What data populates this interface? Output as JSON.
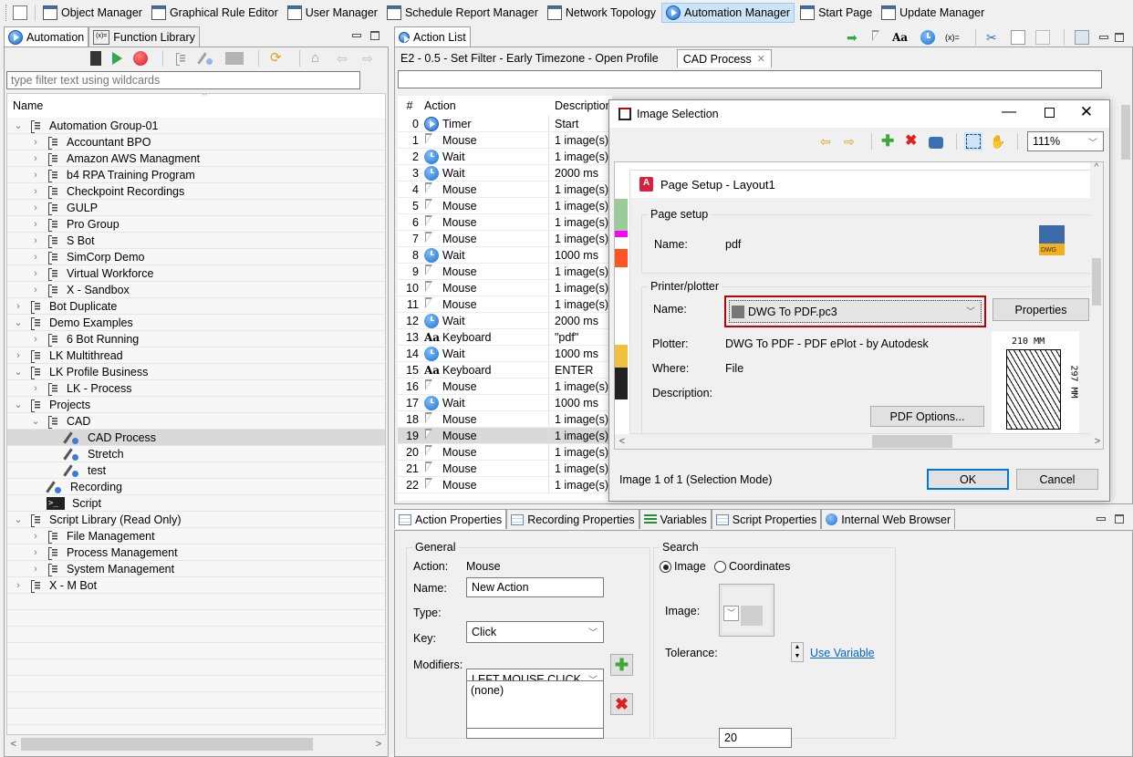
{
  "toolbar": {
    "items": [
      {
        "label": "Object Manager",
        "icon": "object-manager-icon"
      },
      {
        "label": "Graphical Rule Editor",
        "icon": "rule-editor-icon"
      },
      {
        "label": "User Manager",
        "icon": "users-icon"
      },
      {
        "label": "Schedule Report Manager",
        "icon": "schedule-icon"
      },
      {
        "label": "Network Topology",
        "icon": "network-icon"
      },
      {
        "label": "Automation Manager",
        "icon": "automation-icon",
        "active": true
      },
      {
        "label": "Start Page",
        "icon": "checkered-flag-icon"
      },
      {
        "label": "Update Manager",
        "icon": "update-icon"
      }
    ]
  },
  "left_panel": {
    "tabs": [
      {
        "label": "Automation",
        "active": true
      },
      {
        "label": "Function Library"
      }
    ],
    "filter_placeholder": "type filter text using wildcards",
    "column_header": "Name",
    "tree": [
      {
        "label": "Automation Group-01",
        "level": 0,
        "expander": "open",
        "icon": "group"
      },
      {
        "label": "Accountant BPO",
        "level": 1,
        "expander": "closed",
        "icon": "group"
      },
      {
        "label": "Amazon AWS Managment",
        "level": 1,
        "expander": "closed",
        "icon": "group"
      },
      {
        "label": "b4 RPA Training Program",
        "level": 1,
        "expander": "closed",
        "icon": "group"
      },
      {
        "label": "Checkpoint Recordings",
        "level": 1,
        "expander": "closed",
        "icon": "group"
      },
      {
        "label": "GULP",
        "level": 1,
        "expander": "closed",
        "icon": "group"
      },
      {
        "label": "Pro Group",
        "level": 1,
        "expander": "closed",
        "icon": "group"
      },
      {
        "label": "S Bot",
        "level": 1,
        "expander": "closed",
        "icon": "group"
      },
      {
        "label": "SimCorp Demo",
        "level": 1,
        "expander": "closed",
        "icon": "group"
      },
      {
        "label": "Virtual Workforce",
        "level": 1,
        "expander": "closed",
        "icon": "group"
      },
      {
        "label": "X - Sandbox",
        "level": 1,
        "expander": "closed",
        "icon": "group"
      },
      {
        "label": "Bot Duplicate",
        "level": 0,
        "expander": "closed",
        "icon": "group"
      },
      {
        "label": "Demo Examples",
        "level": 0,
        "expander": "open",
        "icon": "group"
      },
      {
        "label": "6 Bot Running",
        "level": 1,
        "expander": "closed",
        "icon": "group"
      },
      {
        "label": "LK Multithread",
        "level": 0,
        "expander": "closed",
        "icon": "group"
      },
      {
        "label": "LK Profile Business",
        "level": 0,
        "expander": "open",
        "icon": "group"
      },
      {
        "label": "LK - Process",
        "level": 1,
        "expander": "closed",
        "icon": "group"
      },
      {
        "label": "Projects",
        "level": 0,
        "expander": "open",
        "icon": "group"
      },
      {
        "label": "CAD",
        "level": 1,
        "expander": "open",
        "icon": "group"
      },
      {
        "label": "CAD Process",
        "level": 2,
        "expander": "none",
        "icon": "recording",
        "selected": true
      },
      {
        "label": "Stretch",
        "level": 2,
        "expander": "none",
        "icon": "recording"
      },
      {
        "label": "test",
        "level": 2,
        "expander": "none",
        "icon": "recording"
      },
      {
        "label": "Recording",
        "level": 1,
        "expander": "none",
        "icon": "recording"
      },
      {
        "label": "Script",
        "level": 1,
        "expander": "none",
        "icon": "script"
      },
      {
        "label": "Script Library (Read Only)",
        "level": 0,
        "expander": "open",
        "icon": "group"
      },
      {
        "label": "File Management",
        "level": 1,
        "expander": "closed",
        "icon": "group"
      },
      {
        "label": "Process Management",
        "level": 1,
        "expander": "closed",
        "icon": "group"
      },
      {
        "label": "System Management",
        "level": 1,
        "expander": "closed",
        "icon": "group"
      },
      {
        "label": "X - M Bot",
        "level": 0,
        "expander": "closed",
        "icon": "group"
      }
    ]
  },
  "action_list": {
    "view_title": "Action List",
    "editor_tabs": [
      {
        "label": "E2 - 0.5 - Set Filter - Early Timezone - Open Profile"
      },
      {
        "label": "CAD Process",
        "active": true,
        "closable": true
      }
    ],
    "columns": [
      "#",
      "Action",
      "Description"
    ],
    "rows": [
      {
        "n": "0",
        "action": "Timer",
        "icon": "timer",
        "desc": "Start"
      },
      {
        "n": "1",
        "action": "Mouse",
        "icon": "mouse",
        "desc": "1 image(s)"
      },
      {
        "n": "2",
        "action": "Wait",
        "icon": "wait",
        "desc": "1 image(s)"
      },
      {
        "n": "3",
        "action": "Wait",
        "icon": "wait",
        "desc": "2000 ms"
      },
      {
        "n": "4",
        "action": "Mouse",
        "icon": "mouse",
        "desc": "1 image(s)"
      },
      {
        "n": "5",
        "action": "Mouse",
        "icon": "mouse",
        "desc": "1 image(s)"
      },
      {
        "n": "6",
        "action": "Mouse",
        "icon": "mouse",
        "desc": "1 image(s)"
      },
      {
        "n": "7",
        "action": "Mouse",
        "icon": "mouse",
        "desc": "1 image(s)"
      },
      {
        "n": "8",
        "action": "Wait",
        "icon": "wait",
        "desc": "1000 ms"
      },
      {
        "n": "9",
        "action": "Mouse",
        "icon": "mouse",
        "desc": "1 image(s)"
      },
      {
        "n": "10",
        "action": "Mouse",
        "icon": "mouse",
        "desc": "1 image(s)"
      },
      {
        "n": "11",
        "action": "Mouse",
        "icon": "mouse",
        "desc": "1 image(s)"
      },
      {
        "n": "12",
        "action": "Wait",
        "icon": "wait",
        "desc": "2000 ms"
      },
      {
        "n": "13",
        "action": "Keyboard",
        "icon": "keyboard",
        "desc": "\"pdf\""
      },
      {
        "n": "14",
        "action": "Wait",
        "icon": "wait",
        "desc": "1000 ms"
      },
      {
        "n": "15",
        "action": "Keyboard",
        "icon": "keyboard",
        "desc": "ENTER"
      },
      {
        "n": "16",
        "action": "Mouse",
        "icon": "mouse",
        "desc": "1 image(s)"
      },
      {
        "n": "17",
        "action": "Wait",
        "icon": "wait",
        "desc": "1000 ms"
      },
      {
        "n": "18",
        "action": "Mouse",
        "icon": "mouse",
        "desc": "1 image(s)"
      },
      {
        "n": "19",
        "action": "Mouse",
        "icon": "mouse",
        "desc": "1 image(s)",
        "selected": true
      },
      {
        "n": "20",
        "action": "Mouse",
        "icon": "mouse",
        "desc": "1 image(s)"
      },
      {
        "n": "21",
        "action": "Mouse",
        "icon": "mouse",
        "desc": "1 image(s)"
      },
      {
        "n": "22",
        "action": "Mouse",
        "icon": "mouse",
        "desc": "1 image(s)"
      }
    ],
    "keyboard_glyph": "Aa"
  },
  "image_dialog": {
    "title": "Image Selection",
    "zoom": "111%",
    "status": "Image 1 of 1 (Selection Mode)",
    "ok_label": "OK",
    "cancel_label": "Cancel",
    "captured": {
      "title": "Page Setup - Layout1",
      "page_setup_group": "Page setup",
      "name_label": "Name:",
      "name_value": "pdf",
      "dwg_badge": "DWG",
      "printer_group": "Printer/plotter",
      "printer_name_label": "Name:",
      "printer_value": "DWG To PDF.pc3",
      "properties_label": "Properties",
      "plotter_label": "Plotter:",
      "plotter_value": "DWG To PDF - PDF ePlot - by Autodesk",
      "where_label": "Where:",
      "where_value": "File",
      "description_label": "Description:",
      "pdf_options_label": "PDF Options...",
      "paper_width": "210 MM",
      "paper_height": "297 MM"
    }
  },
  "bottom_tabs": [
    {
      "label": "Action Properties",
      "active": true
    },
    {
      "label": "Recording Properties"
    },
    {
      "label": "Variables"
    },
    {
      "label": "Script Properties"
    },
    {
      "label": "Internal Web Browser"
    }
  ],
  "properties": {
    "general_title": "General",
    "action_label": "Action:",
    "action_value": "Mouse",
    "name_label": "Name:",
    "name_value": "New Action",
    "type_label": "Type:",
    "type_value": "Click",
    "key_label": "Key:",
    "key_value": "LEFT MOUSE CLICK",
    "modifiers_label": "Modifiers:",
    "modifiers_value": "",
    "modifiers_list": "(none)",
    "search_title": "Search",
    "radio_image": "Image",
    "radio_coordinates": "Coordinates",
    "search_mode": "Image",
    "image_label": "Image:",
    "tolerance_label": "Tolerance:",
    "tolerance_value": "20",
    "use_variable_link": "Use Variable"
  },
  "colors": {
    "accent": "#0078d7",
    "selection": "#d9d9d9",
    "active_tool": "#cce4f7",
    "highlight_border": "#c00000",
    "link": "#0066cc"
  }
}
